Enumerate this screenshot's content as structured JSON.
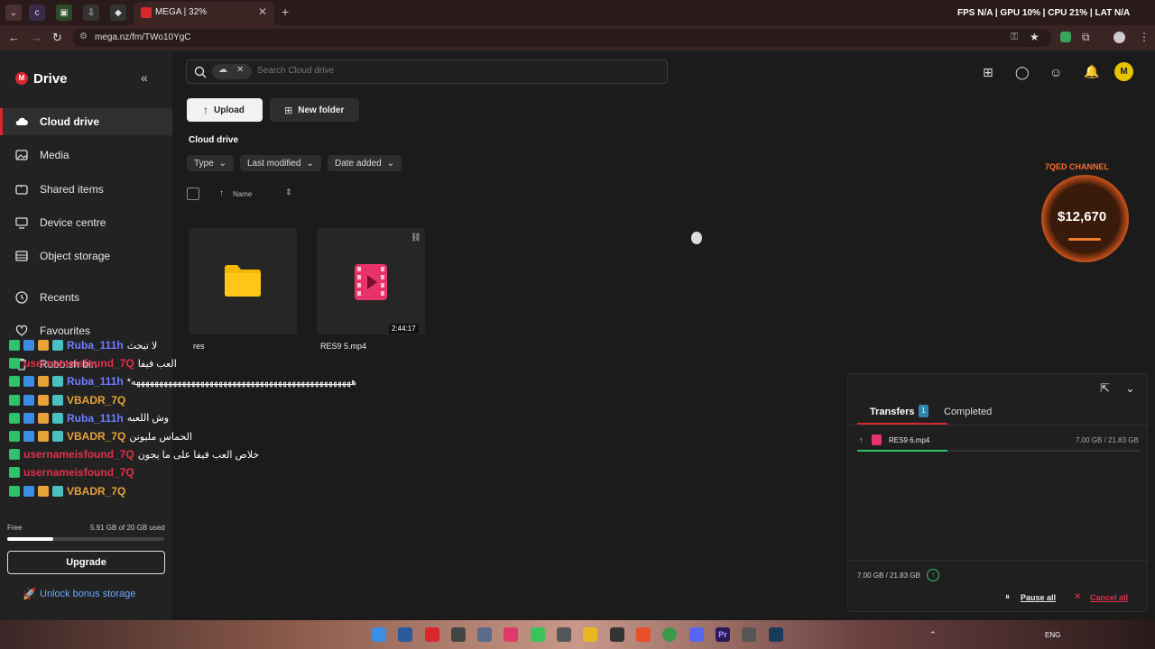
{
  "browser": {
    "tab_title": "MEGA | 32%",
    "url": "mega.nz/fm/TWo10YgC",
    "overlay_stats": "FPS N/A | GPU 10% | CPU 21% | LAT N/A"
  },
  "sidebar": {
    "app_name": "Drive",
    "items": [
      {
        "label": "Cloud drive"
      },
      {
        "label": "Media"
      },
      {
        "label": "Shared items"
      },
      {
        "label": "Device centre"
      },
      {
        "label": "Object storage"
      },
      {
        "label": "Recents"
      },
      {
        "label": "Favourites"
      },
      {
        "label": "Rubbish bin"
      }
    ],
    "storage_label": "Free",
    "storage_used": "5.91 GB of 20 GB used",
    "storage_fraction": 0.2955,
    "upgrade_label": "Upgrade",
    "bonus_label": "Unlock bonus storage"
  },
  "search": {
    "placeholder": "Search Cloud drive"
  },
  "toolbar": {
    "upload_label": "Upload",
    "new_folder_label": "New folder"
  },
  "breadcrumb": "Cloud drive",
  "filters": [
    "Type",
    "Last modified",
    "Date added"
  ],
  "list_header": {
    "name_label": "Name"
  },
  "files": [
    {
      "name": "res",
      "kind": "folder"
    },
    {
      "name": "RES9 5.mp4",
      "kind": "video",
      "duration": "2:44:17"
    }
  ],
  "stream_overlay": {
    "channel": "7QED CHANNEL",
    "amount": "$12,670"
  },
  "transfers": {
    "tab_transfers": "Transfers",
    "tab_count": "1",
    "tab_completed": "Completed",
    "items": [
      {
        "name": "RES9 6.mp4",
        "progress": "7.00 GB / 21.83 GB",
        "fraction": 0.32
      }
    ],
    "footer_progress": "7.00 GB / 21.83 GB",
    "pause_all": "Pause all",
    "cancel_all": "Cancel all"
  },
  "chat": [
    {
      "user": "Ruba_111h",
      "color": "#6f7dff",
      "msg": "لا تبحث"
    },
    {
      "user": "usernameisfound_7Q",
      "color": "#e0304a",
      "msg": "العب فيفا"
    },
    {
      "user": "Ruba_111h",
      "color": "#6f7dff",
      "msg": "*ههههههههههههههههههههههههههههههههههههههههههههههههه"
    },
    {
      "user": "VBADR_7Q",
      "color": "#e8a23a",
      "msg": ""
    },
    {
      "user": "Ruba_111h",
      "color": "#6f7dff",
      "msg": "وش اللعبه"
    },
    {
      "user": "VBADR_7Q",
      "color": "#e8a23a",
      "msg": "الحماس مليونن"
    },
    {
      "user": "usernameisfound_7Q",
      "color": "#e0304a",
      "msg": "خلاص العب فيفا على ما يجون"
    },
    {
      "user": "usernameisfound_7Q",
      "color": "#e0304a",
      "msg": ""
    },
    {
      "user": "VBADR_7Q",
      "color": "#e8a23a",
      "msg": ""
    }
  ],
  "taskbar": {
    "lang": "ENG"
  }
}
